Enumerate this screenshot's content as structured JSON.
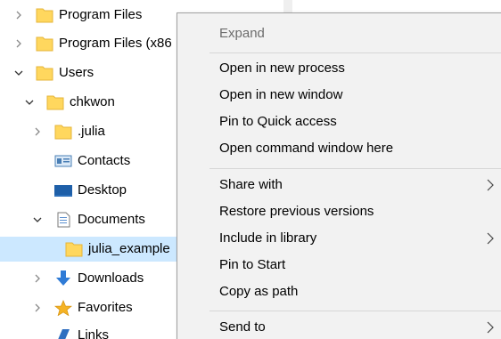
{
  "tree": {
    "items": [
      {
        "label": "Program Files",
        "icon": "folder-icon",
        "expand": "collapsed"
      },
      {
        "label": "Program Files (x86",
        "icon": "folder-icon",
        "expand": "collapsed"
      },
      {
        "label": "Users",
        "icon": "folder-icon",
        "expand": "expanded"
      },
      {
        "label": "chkwon",
        "icon": "folder-icon",
        "expand": "expanded"
      },
      {
        "label": ".julia",
        "icon": "folder-icon",
        "expand": "collapsed"
      },
      {
        "label": "Contacts",
        "icon": "contacts-icon",
        "expand": "none"
      },
      {
        "label": "Desktop",
        "icon": "desktop-icon",
        "expand": "none"
      },
      {
        "label": "Documents",
        "icon": "documents-icon",
        "expand": "expanded"
      },
      {
        "label": "julia_example",
        "icon": "folder-icon",
        "expand": "none",
        "selected": true
      },
      {
        "label": "Downloads",
        "icon": "downloads-icon",
        "expand": "collapsed"
      },
      {
        "label": "Favorites",
        "icon": "favorites-icon",
        "expand": "collapsed"
      },
      {
        "label": "Links",
        "icon": "links-icon",
        "expand": "none"
      }
    ]
  },
  "context_menu": {
    "expand": "Expand",
    "open_new_process": "Open in new process",
    "open_new_window": "Open in new window",
    "pin_quick_access": "Pin to Quick access",
    "open_command_window": "Open command window here",
    "share_with": "Share with",
    "restore_versions": "Restore previous versions",
    "include_library": "Include in library",
    "pin_start": "Pin to Start",
    "copy_path": "Copy as path",
    "send_to": "Send to"
  },
  "colors": {
    "selection": "#cce8ff",
    "menu_bg": "#f2f2f2",
    "folder": "#ffd75e"
  }
}
